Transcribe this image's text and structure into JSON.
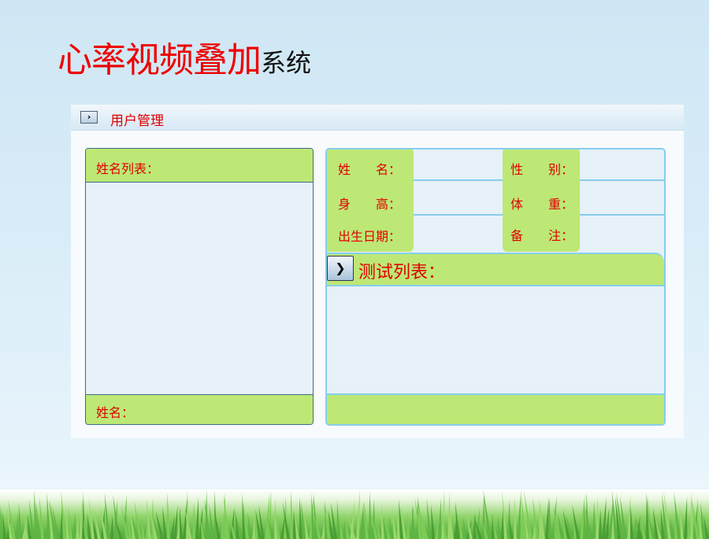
{
  "title": {
    "red": "心率视频叠加",
    "black": "系统"
  },
  "panel": {
    "header_button": "›",
    "header_label": "用户管理"
  },
  "name_list": {
    "header": "姓名列表：",
    "footer": "姓名："
  },
  "fields": {
    "name": "姓　　名：",
    "gender": "性　　别：",
    "height": "身　　高：",
    "weight": "体　　重：",
    "birth": "出生日期：",
    "remark": "备　　注："
  },
  "test_list": {
    "button": "❯",
    "label": "测试列表："
  },
  "colors": {
    "accent_red": "#e00000",
    "label_green": "#bde876",
    "frame_blue": "#87cdec"
  }
}
